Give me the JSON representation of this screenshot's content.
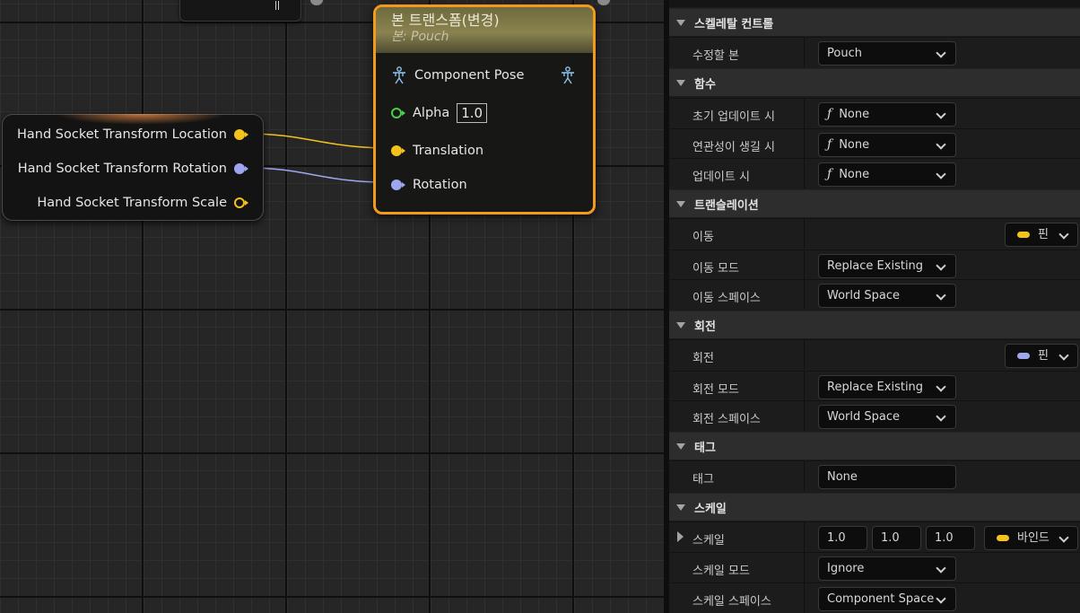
{
  "graph": {
    "bone_transform_node": {
      "title": "본 트랜스폼(변경)",
      "subtitle": "본: Pouch",
      "pins": {
        "component_pose": "Component Pose",
        "alpha": "Alpha",
        "alpha_value": "1.0",
        "translation": "Translation",
        "rotation": "Rotation"
      }
    },
    "variable_node": {
      "outputs": [
        "Hand Socket Transform Location",
        "Hand Socket Transform Rotation",
        "Hand Socket Transform Scale"
      ]
    }
  },
  "details": {
    "categories": {
      "skeletal_control": "스켈레탈 컨트롤",
      "functions": "함수",
      "translation": "트랜슬레이션",
      "rotation": "회전",
      "tag": "태그",
      "scale": "스케일"
    },
    "bone_to_modify": {
      "label": "수정할 본",
      "value": "Pouch"
    },
    "on_initial_update": {
      "label": "초기 업데이트 시",
      "value": "None"
    },
    "on_become_relevant": {
      "label": "연관성이 생길 시",
      "value": "None"
    },
    "on_update": {
      "label": "업데이트 시",
      "value": "None"
    },
    "function_icon": "ƒ",
    "translation_row": {
      "label": "이동",
      "pin_label": "핀"
    },
    "translation_mode": {
      "label": "이동 모드",
      "value": "Replace Existing"
    },
    "translation_space": {
      "label": "이동 스페이스",
      "value": "World Space"
    },
    "rotation_row": {
      "label": "회전",
      "pin_label": "핀"
    },
    "rotation_mode": {
      "label": "회전 모드",
      "value": "Replace Existing"
    },
    "rotation_space": {
      "label": "회전 스페이스",
      "value": "World Space"
    },
    "tag_row": {
      "label": "태그",
      "value": "None"
    },
    "scale_row": {
      "label": "스케일",
      "x": "1.0",
      "y": "1.0",
      "z": "1.0",
      "bind_label": "바인드"
    },
    "scale_mode": {
      "label": "스케일 모드",
      "value": "Ignore"
    },
    "scale_space": {
      "label": "스케일 스페이스",
      "value": "Component Space"
    }
  },
  "colors": {
    "pin_vector": "#f3c21c",
    "pin_rotator": "#9ea6f0",
    "pin_float": "#4bd04b",
    "node_selected_border": "#f19a1d"
  }
}
